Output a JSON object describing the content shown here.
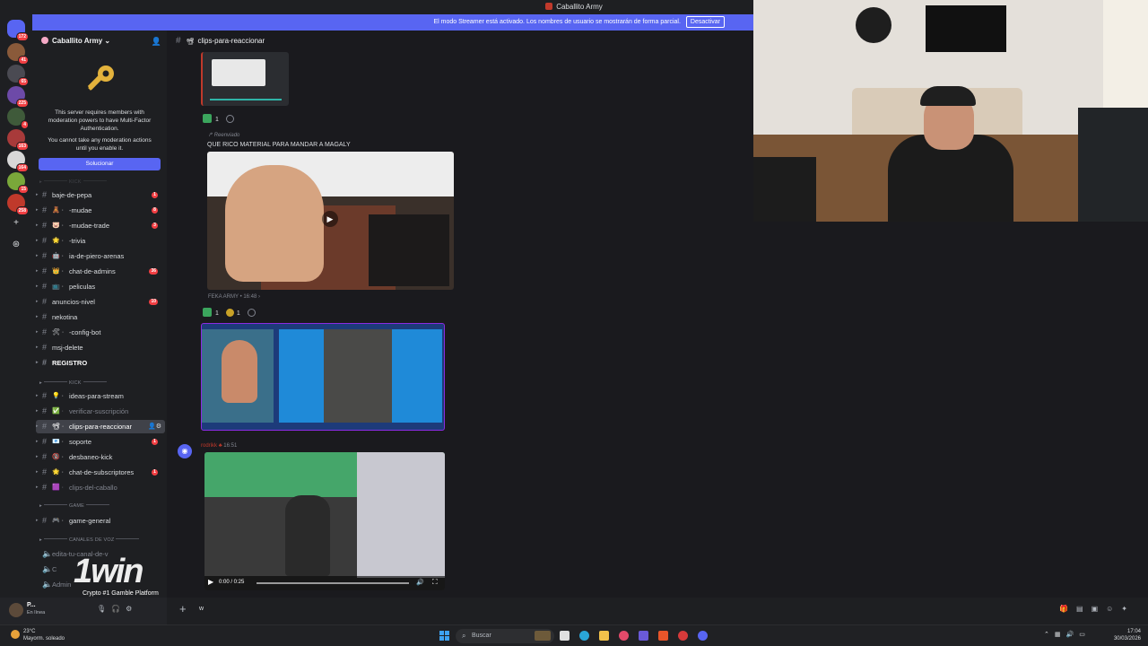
{
  "titlebar": {
    "title": "Caballito Army"
  },
  "banner": {
    "text": "El modo Streamer está activado. Los nombres de usuario se mostrarán de forma parcial.",
    "button": "Desactivar"
  },
  "rail": {
    "badges": [
      "172",
      "41",
      "65",
      "225",
      "4",
      "163",
      "164",
      "15",
      "258"
    ]
  },
  "server": {
    "name": "Caballito Army",
    "mfa_text_1": "This server requires members with moderation powers to have Multi-Factor Authentication.",
    "mfa_text_2": "You cannot take any moderation actions until you enable it.",
    "mfa_button": "Solucionar"
  },
  "categories": {
    "kick": "KICK",
    "game": "GAME",
    "voice": "CANALES DE VOZ"
  },
  "channels": [
    {
      "label": "baje-de-pepa",
      "emoji": "",
      "count": "1"
    },
    {
      "label": "-mudae",
      "emoji": "🧸",
      "count": "8"
    },
    {
      "label": "-mudae-trade",
      "emoji": "🐷",
      "count": "3"
    },
    {
      "label": "-trivia",
      "emoji": "🌟",
      "count": ""
    },
    {
      "label": "ia-de-piero-arenas",
      "emoji": "🤖",
      "count": ""
    },
    {
      "label": "chat-de-admins",
      "emoji": "👑",
      "count": "36"
    },
    {
      "label": "peliculas",
      "emoji": "📺",
      "count": ""
    },
    {
      "label": "anuncios-nivel",
      "emoji": "",
      "count": "10"
    },
    {
      "label": "nekotina",
      "emoji": "",
      "count": ""
    },
    {
      "label": "-config-bot",
      "emoji": "🛠",
      "count": ""
    },
    {
      "label": "msj-delete",
      "emoji": "",
      "count": ""
    },
    {
      "label": "REGISTRO",
      "emoji": "",
      "count": ""
    }
  ],
  "kick_channels": [
    {
      "label": "ideas-para-stream",
      "emoji": "💡",
      "count": ""
    },
    {
      "label": "verificar-suscripción",
      "emoji": "✅",
      "count": ""
    },
    {
      "label": "clips-para-reaccionar",
      "emoji": "📽",
      "count": ""
    },
    {
      "label": "soporte",
      "emoji": "📧",
      "count": "1"
    },
    {
      "label": "desbaneo-kick",
      "emoji": "🔞",
      "count": ""
    },
    {
      "label": "chat-de-subscriptores",
      "emoji": "🌟",
      "count": "1"
    },
    {
      "label": "clips-del-caballo",
      "emoji": "🟪",
      "count": ""
    }
  ],
  "game_channels": [
    {
      "label": "game-general",
      "emoji": "🎮",
      "count": ""
    }
  ],
  "voice_channels": [
    {
      "label": "edita-tu-canal-de-v"
    },
    {
      "label": "C"
    },
    {
      "label": "Admin"
    }
  ],
  "user": {
    "name": "P...",
    "status": "En línea"
  },
  "promo": {
    "brand": "1win",
    "tagline": "Crypto #1 Gamble Platform"
  },
  "chat": {
    "channel": "clips-para-reaccionar",
    "reaction_count_1": "1",
    "forwarded_label": "Reenviado",
    "message_text": "QUE RICO MATERIAL PARA MANDAR A MAGALY",
    "forward_source": "FEKA ARMY",
    "forward_time": "16:48",
    "reaction_count_2": "1",
    "reaction_count_3": "1",
    "author": "rodrikk",
    "author_time": "16:51",
    "video_time": "0:00 / 0:25"
  },
  "input": {
    "text": "w"
  },
  "taskbar": {
    "weather_temp": "23°C",
    "weather_desc": "Mayorm. soleado",
    "search_placeholder": "Buscar",
    "time": "17:04",
    "date": "30/03/2026"
  }
}
